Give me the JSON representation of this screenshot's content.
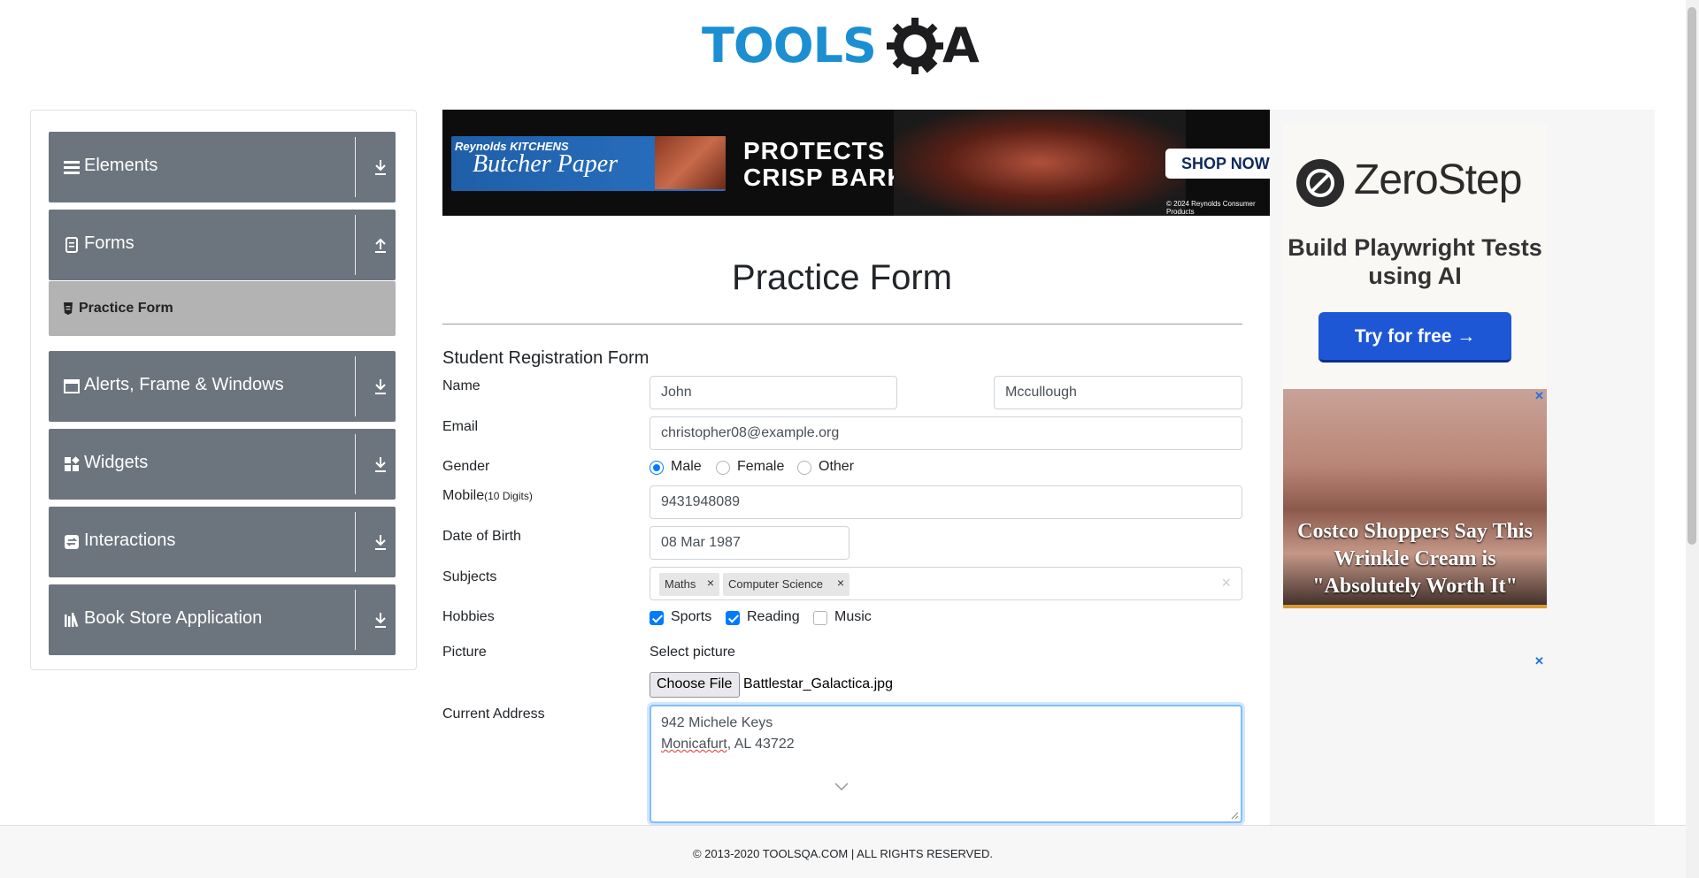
{
  "logo": {
    "part1": "TOOLS",
    "part2": "A"
  },
  "sidebar": {
    "groups": [
      {
        "label": "Elements",
        "icon": "hamburger-icon",
        "arrow": "download-icon"
      },
      {
        "label": "Forms",
        "icon": "document-icon",
        "arrow": "upload-icon"
      },
      {
        "label": "Alerts, Frame & Windows",
        "icon": "window-icon",
        "arrow": "download-icon"
      },
      {
        "label": "Widgets",
        "icon": "widgets-icon",
        "arrow": "download-icon"
      },
      {
        "label": "Interactions",
        "icon": "interactions-icon",
        "arrow": "download-icon"
      },
      {
        "label": "Book Store Application",
        "icon": "books-icon",
        "arrow": "download-icon"
      }
    ],
    "active_item": {
      "label": "Practice Form",
      "icon": "html-icon"
    }
  },
  "banner": {
    "brand": "Reynolds KITCHENS",
    "product": "Butcher Paper",
    "headline_1": "PROTECTS",
    "headline_2": "CRISP BARK",
    "cta": "SHOP NOW",
    "copyright": "© 2024 Reynolds Consumer Products"
  },
  "form": {
    "page_title": "Practice Form",
    "subtitle": "Student Registration Form",
    "labels": {
      "name": "Name",
      "email": "Email",
      "gender": "Gender",
      "mobile": "Mobile",
      "mobile_hint": "(10 Digits)",
      "dob": "Date of Birth",
      "subjects": "Subjects",
      "hobbies": "Hobbies",
      "picture": "Picture",
      "address": "Current Address"
    },
    "first_name": "John",
    "last_name": "Mccullough",
    "email": "christopher08@example.org",
    "gender_options": [
      "Male",
      "Female",
      "Other"
    ],
    "gender_selected": "Male",
    "mobile": "9431948089",
    "dob": "08 Mar 1987",
    "subjects": [
      "Maths",
      "Computer Science"
    ],
    "subjects_clear": "×",
    "subject_remove": "×",
    "hobbies": [
      {
        "label": "Sports",
        "checked": true
      },
      {
        "label": "Reading",
        "checked": true
      },
      {
        "label": "Music",
        "checked": false
      }
    ],
    "picture_label": "Select picture",
    "choose_file": "Choose File",
    "file_name": "Battlestar_Galactica.jpg",
    "address_line1": "942 Michele Keys",
    "address_city": "Monicafurt",
    "address_rest": ", AL 43722"
  },
  "ads": {
    "zerostep_name": "ZeroStep",
    "zerostep_tagline": "Build Playwright Tests using AI",
    "zerostep_cta": "Try for free →",
    "ad2_text": "Costco Shoppers Say This Wrinkle Cream is \"Absolutely Worth It\"",
    "close_glyph": "✕"
  },
  "footer": {
    "text": "© 2013-2020 TOOLSQA.COM | ALL RIGHTS RESERVED."
  },
  "colors": {
    "sidebar_group": "#6c757d",
    "active_item": "#b3b3b3",
    "accent": "#007bff",
    "logo_blue": "#1b8fd2"
  }
}
